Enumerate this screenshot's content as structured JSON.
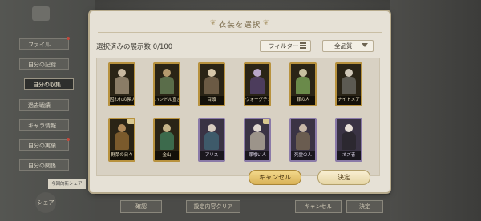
{
  "sidebar": {
    "items": [
      {
        "label": "ファイル"
      },
      {
        "label": "自分の記録"
      },
      {
        "label": "自分の収集"
      },
      {
        "label": "過去戦績"
      },
      {
        "label": "キャラ情報"
      },
      {
        "label": "自分の実績"
      },
      {
        "label": "自分の関係"
      }
    ],
    "tooltip": "今回的新シェア",
    "claim": "シェア"
  },
  "bottom_bar": {
    "left_label": "確認",
    "mid_label": "設定内容クリア",
    "right_label": "キャンセル",
    "far_label": "決定"
  },
  "dialog": {
    "title": "衣装を選択",
    "count_label": "選択済みの展示数 0/100",
    "filter_label": "フィルター",
    "sort_value": "全品質",
    "cancel_label": "キャンセル",
    "confirm_label": "決定"
  },
  "cards": [
    {
      "name": "囚われの隣人",
      "frame": "gold",
      "badge": "",
      "head": "#c9b9a0",
      "body": "#8a7c66"
    },
    {
      "name": "ハンドル宣言",
      "frame": "gold",
      "badge": "",
      "head": "#b59a6e",
      "body": "#5a6d4a"
    },
    {
      "name": "百頭",
      "frame": "gold",
      "badge": "",
      "head": "#d6c6a8",
      "body": "#6b5a44"
    },
    {
      "name": "ヴォーグチェス",
      "frame": "gold",
      "badge": "",
      "head": "#b8a6c8",
      "body": "#4c3c5c"
    },
    {
      "name": "罪の人",
      "frame": "gold",
      "badge": "",
      "head": "#c8c0a0",
      "body": "#6a8a4a"
    },
    {
      "name": "ナイトメア",
      "frame": "gold",
      "badge": "",
      "head": "#d0c8b8",
      "body": "#5c5a52"
    },
    {
      "name": "野菜の日々",
      "frame": "gold",
      "badge": "new",
      "head": "#b08a5a",
      "body": "#7a5a2c"
    },
    {
      "name": "金山",
      "frame": "gold",
      "badge": "",
      "head": "#c6b488",
      "body": "#3c6a4c"
    },
    {
      "name": "アリス",
      "frame": "purple",
      "badge": "",
      "head": "#d8ccc0",
      "body": "#3e5a6a"
    },
    {
      "name": "罪喰い人",
      "frame": "purple",
      "badge": "new",
      "head": "#e0d8d0",
      "body": "#9c948a"
    },
    {
      "name": "死霊の人",
      "frame": "purple",
      "badge": "",
      "head": "#c8b8a8",
      "body": "#6a5c50"
    },
    {
      "name": "オズ者",
      "frame": "purple",
      "badge": "",
      "head": "#e8e0d8",
      "body": "#2c2830"
    }
  ]
}
